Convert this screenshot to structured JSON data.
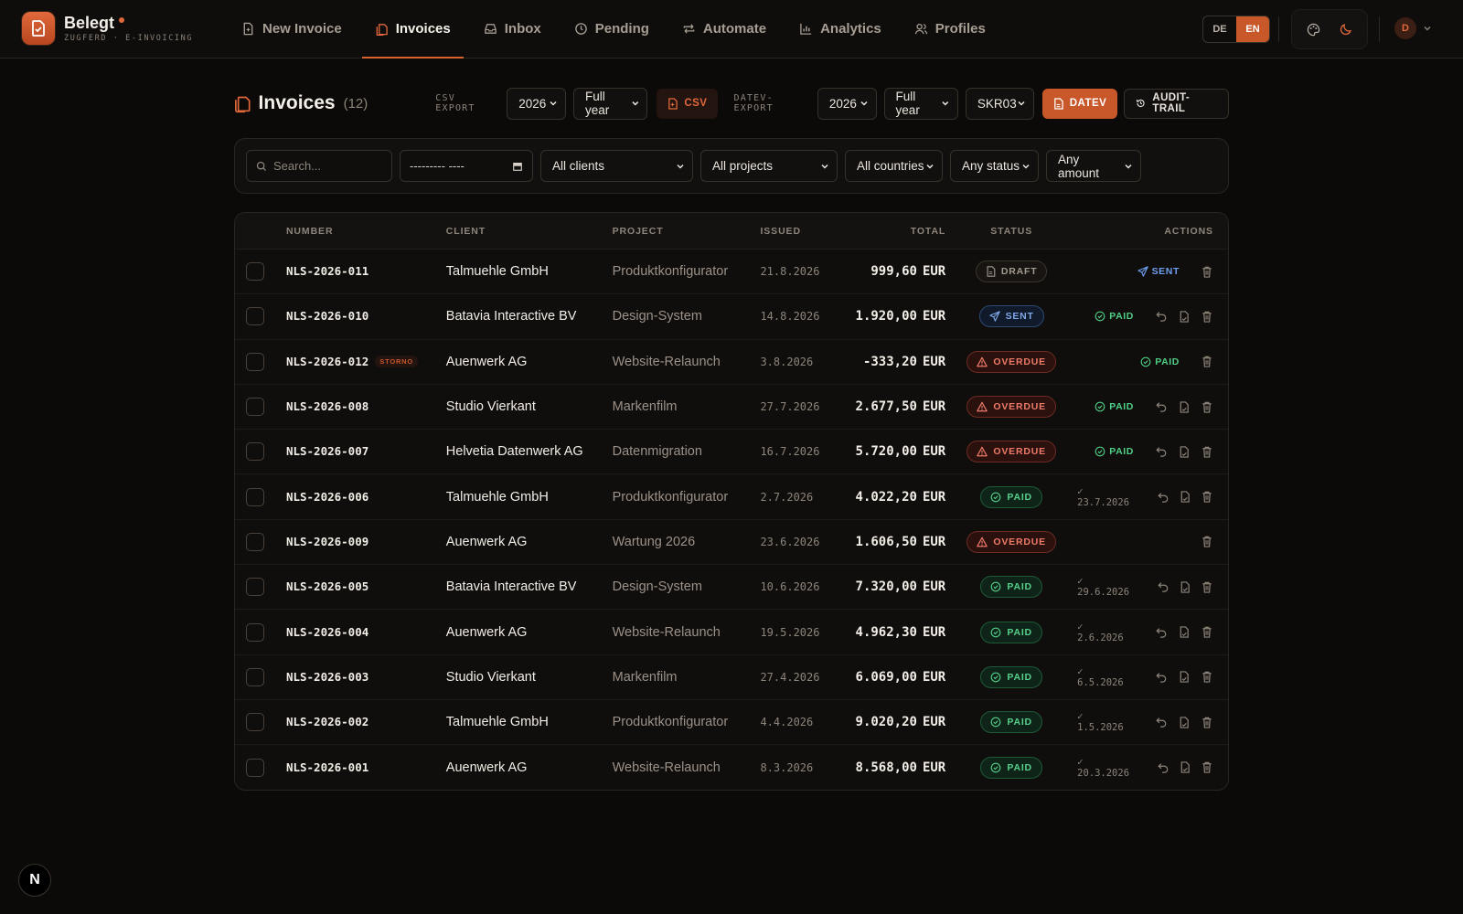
{
  "brand": {
    "name": "Belegt",
    "subtitle": "ZUGFERD · E-INVOICING"
  },
  "nav": [
    {
      "label": "New Invoice",
      "icon": "file-plus-icon",
      "active": false
    },
    {
      "label": "Invoices",
      "icon": "files-icon",
      "active": true
    },
    {
      "label": "Inbox",
      "icon": "inbox-icon",
      "active": false
    },
    {
      "label": "Pending",
      "icon": "clock-icon",
      "active": false
    },
    {
      "label": "Automate",
      "icon": "repeat-icon",
      "active": false
    },
    {
      "label": "Analytics",
      "icon": "bar-chart-icon",
      "active": false
    },
    {
      "label": "Profiles",
      "icon": "users-icon",
      "active": false
    }
  ],
  "lang": {
    "de": "DE",
    "en": "EN",
    "active": "EN"
  },
  "user": {
    "initial": "D"
  },
  "page": {
    "title": "Invoices",
    "count": "(12)"
  },
  "csv_export": {
    "label": "CSV EXPORT",
    "year": "2026",
    "period": "Full year",
    "button": "CSV"
  },
  "datev_export": {
    "label": "DATEV-EXPORT",
    "year": "2026",
    "period": "Full year",
    "chart": "SKR03",
    "button": "DATEV",
    "audit": "AUDIT-TRAIL"
  },
  "filters": {
    "search_placeholder": "Search...",
    "date": "--------- ----",
    "clients": "All clients",
    "projects": "All projects",
    "countries": "All countries",
    "status": "Any status",
    "amount": "Any amount"
  },
  "table": {
    "columns": {
      "number": "NUMBER",
      "client": "CLIENT",
      "project": "PROJECT",
      "issued": "ISSUED",
      "total": "TOTAL",
      "status": "STATUS",
      "actions": "ACTIONS"
    },
    "rows": [
      {
        "number": "NLS-2026-011",
        "storno": "",
        "client": "Talmuehle GmbH",
        "project": "Produktkonfigurator",
        "issued": "21.8.2026",
        "amount": "999,60",
        "currency": "EUR",
        "status": "DRAFT",
        "status_kind": "draft",
        "action": "SENT",
        "action_kind": "sent",
        "paid_date": "",
        "icons": [
          "trash"
        ]
      },
      {
        "number": "NLS-2026-010",
        "storno": "",
        "client": "Batavia Interactive BV",
        "project": "Design-System",
        "issued": "14.8.2026",
        "amount": "1.920,00",
        "currency": "EUR",
        "status": "SENT",
        "status_kind": "sent",
        "action": "PAID",
        "action_kind": "paid",
        "paid_date": "",
        "icons": [
          "undo",
          "doc",
          "trash"
        ]
      },
      {
        "number": "NLS-2026-012",
        "storno": "STORNO",
        "client": "Auenwerk AG",
        "project": "Website-Relaunch",
        "issued": "3.8.2026",
        "amount": "-333,20",
        "currency": "EUR",
        "status": "OVERDUE",
        "status_kind": "overdue",
        "action": "PAID",
        "action_kind": "paid",
        "paid_date": "",
        "icons": [
          "trash"
        ]
      },
      {
        "number": "NLS-2026-008",
        "storno": "",
        "client": "Studio Vierkant",
        "project": "Markenfilm",
        "issued": "27.7.2026",
        "amount": "2.677,50",
        "currency": "EUR",
        "status": "OVERDUE",
        "status_kind": "overdue",
        "action": "PAID",
        "action_kind": "paid",
        "paid_date": "",
        "icons": [
          "undo",
          "doc",
          "trash"
        ]
      },
      {
        "number": "NLS-2026-007",
        "storno": "",
        "client": "Helvetia Datenwerk AG",
        "project": "Datenmigration",
        "issued": "16.7.2026",
        "amount": "5.720,00",
        "currency": "EUR",
        "status": "OVERDUE",
        "status_kind": "overdue",
        "action": "PAID",
        "action_kind": "paid",
        "paid_date": "",
        "icons": [
          "undo",
          "doc",
          "trash"
        ]
      },
      {
        "number": "NLS-2026-006",
        "storno": "",
        "client": "Talmuehle GmbH",
        "project": "Produktkonfigurator",
        "issued": "2.7.2026",
        "amount": "4.022,20",
        "currency": "EUR",
        "status": "PAID",
        "status_kind": "paid",
        "action": "",
        "action_kind": "",
        "paid_date": "✓ 23.7.2026",
        "icons": [
          "undo",
          "doc",
          "trash"
        ]
      },
      {
        "number": "NLS-2026-009",
        "storno": "",
        "client": "Auenwerk AG",
        "project": "Wartung 2026",
        "issued": "23.6.2026",
        "amount": "1.606,50",
        "currency": "EUR",
        "status": "OVERDUE",
        "status_kind": "overdue",
        "action": "",
        "action_kind": "",
        "paid_date": "",
        "icons": [
          "trash"
        ]
      },
      {
        "number": "NLS-2026-005",
        "storno": "",
        "client": "Batavia Interactive BV",
        "project": "Design-System",
        "issued": "10.6.2026",
        "amount": "7.320,00",
        "currency": "EUR",
        "status": "PAID",
        "status_kind": "paid",
        "action": "",
        "action_kind": "",
        "paid_date": "✓ 29.6.2026",
        "icons": [
          "undo",
          "doc",
          "trash"
        ]
      },
      {
        "number": "NLS-2026-004",
        "storno": "",
        "client": "Auenwerk AG",
        "project": "Website-Relaunch",
        "issued": "19.5.2026",
        "amount": "4.962,30",
        "currency": "EUR",
        "status": "PAID",
        "status_kind": "paid",
        "action": "",
        "action_kind": "",
        "paid_date": "✓ 2.6.2026",
        "icons": [
          "undo",
          "doc",
          "trash"
        ]
      },
      {
        "number": "NLS-2026-003",
        "storno": "",
        "client": "Studio Vierkant",
        "project": "Markenfilm",
        "issued": "27.4.2026",
        "amount": "6.069,00",
        "currency": "EUR",
        "status": "PAID",
        "status_kind": "paid",
        "action": "",
        "action_kind": "",
        "paid_date": "✓ 6.5.2026",
        "icons": [
          "undo",
          "doc",
          "trash"
        ]
      },
      {
        "number": "NLS-2026-002",
        "storno": "",
        "client": "Talmuehle GmbH",
        "project": "Produktkonfigurator",
        "issued": "4.4.2026",
        "amount": "9.020,20",
        "currency": "EUR",
        "status": "PAID",
        "status_kind": "paid",
        "action": "",
        "action_kind": "",
        "paid_date": "✓ 1.5.2026",
        "icons": [
          "undo",
          "doc",
          "trash"
        ]
      },
      {
        "number": "NLS-2026-001",
        "storno": "",
        "client": "Auenwerk AG",
        "project": "Website-Relaunch",
        "issued": "8.3.2026",
        "amount": "8.568,00",
        "currency": "EUR",
        "status": "PAID",
        "status_kind": "paid",
        "action": "",
        "action_kind": "",
        "paid_date": "✓ 20.3.2026",
        "icons": [
          "undo",
          "doc",
          "trash"
        ]
      }
    ]
  },
  "corner_badge": "N",
  "colors": {
    "accent": "#c8572a",
    "background": "#0c0a08",
    "paid": "#55d08a",
    "overdue": "#ee7a68",
    "sent": "#7fa8e8"
  }
}
